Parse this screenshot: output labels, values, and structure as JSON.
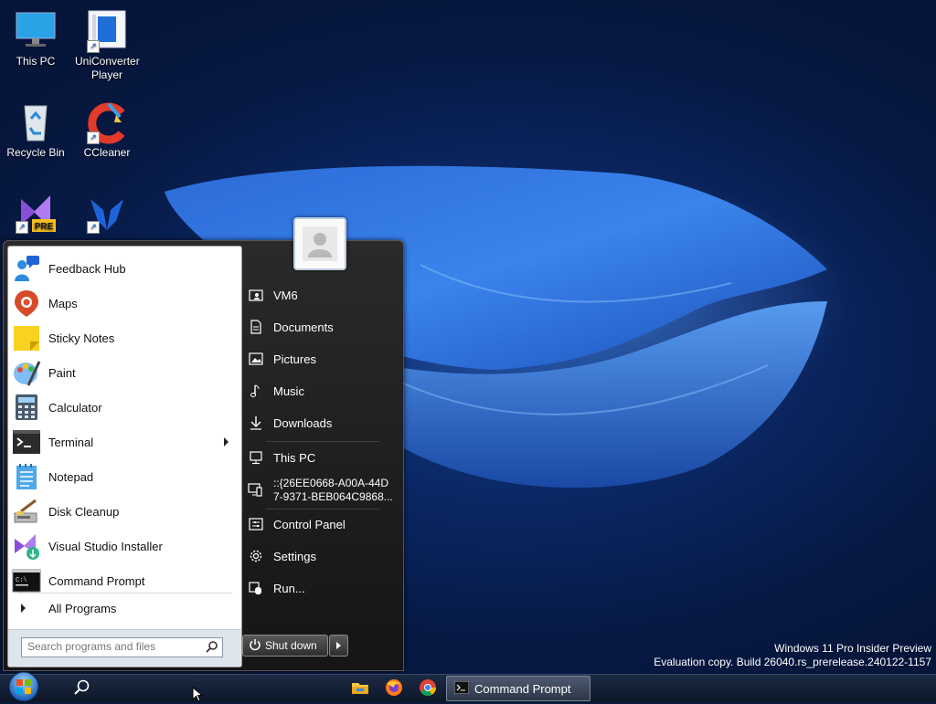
{
  "desktop": {
    "icons": [
      {
        "label": "This PC",
        "icon": "monitor-icon"
      },
      {
        "label": "UniConverter Player",
        "icon": "uniconverter-icon"
      },
      {
        "label": "Recycle Bin",
        "icon": "recycle-bin-icon"
      },
      {
        "label": "CCleaner",
        "icon": "ccleaner-icon"
      },
      {
        "label": "",
        "icon": "visual-studio-preview-icon",
        "badge": "PRE"
      },
      {
        "label": "",
        "icon": "malwarebytes-icon"
      }
    ]
  },
  "start_menu": {
    "programs": [
      {
        "label": "Feedback Hub",
        "icon": "feedback-hub-icon"
      },
      {
        "label": "Maps",
        "icon": "maps-icon"
      },
      {
        "label": "Sticky Notes",
        "icon": "sticky-notes-icon"
      },
      {
        "label": "Paint",
        "icon": "paint-icon"
      },
      {
        "label": "Calculator",
        "icon": "calculator-icon"
      },
      {
        "label": "Terminal",
        "icon": "terminal-icon",
        "has_submenu": true
      },
      {
        "label": "Notepad",
        "icon": "notepad-icon"
      },
      {
        "label": "Disk Cleanup",
        "icon": "disk-cleanup-icon"
      },
      {
        "label": "Visual Studio Installer",
        "icon": "visual-studio-installer-icon"
      },
      {
        "label": "Command Prompt",
        "icon": "command-prompt-icon"
      }
    ],
    "all_programs_label": "All Programs",
    "search": {
      "placeholder": "Search programs and files",
      "value": ""
    },
    "right_items": [
      {
        "label": "VM6",
        "icon": "user-folder-icon"
      },
      {
        "label": "Documents",
        "icon": "document-icon"
      },
      {
        "label": "Pictures",
        "icon": "picture-icon"
      },
      {
        "label": "Music",
        "icon": "music-note-icon"
      },
      {
        "label": "Downloads",
        "icon": "download-arrow-icon"
      },
      {
        "label": "This PC",
        "icon": "computer-icon"
      },
      {
        "label_line1": "::{26EE0668-A00A-44D",
        "label_line2": "7-9371-BEB064C9868...",
        "icon": "network-device-icon"
      },
      {
        "label": "Control Panel",
        "icon": "control-panel-icon"
      },
      {
        "label": "Settings",
        "icon": "settings-gear-icon"
      },
      {
        "label": "Run...",
        "icon": "run-icon"
      }
    ],
    "shutdown_label": "Shut down"
  },
  "watermark": {
    "line1": "Windows 11 Pro Insider Preview",
    "line2": "Evaluation copy. Build 26040.rs_prerelease.240122-1157"
  },
  "taskbar": {
    "active_task_label": "Command Prompt",
    "pinned": [
      "search-icon",
      "file-explorer-icon",
      "firefox-icon",
      "chrome-icon"
    ]
  },
  "colors": {
    "desktop_bg": "#0a2560",
    "wave": "#2f6fd6",
    "start_menu_dark": "#1b1b1b",
    "taskbar": "#15213a"
  }
}
